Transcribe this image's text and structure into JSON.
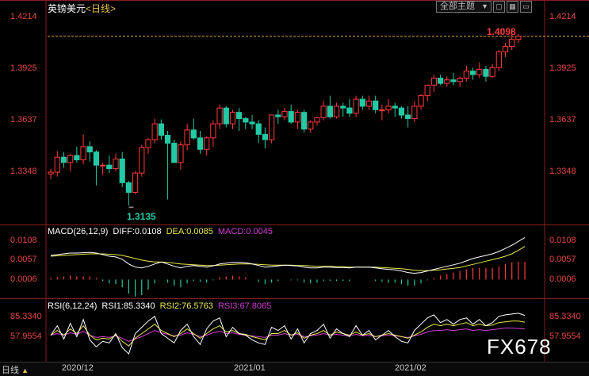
{
  "header": {
    "title": "英镑美元",
    "period_tag": "<日线>"
  },
  "toolbar": {
    "theme_select": "全部主题",
    "theme_arrow": "▼",
    "btn1": "▢",
    "btn2": "▦",
    "btn3": "▭"
  },
  "price_axis": {
    "labels": [
      "1.4214",
      "1.3925",
      "1.3637",
      "1.3348"
    ]
  },
  "markers": {
    "high": "1.4098",
    "low": "1.3135"
  },
  "macd": {
    "name": "MACD(26,12,9)",
    "diff": "DIFF:0.0108",
    "dea": "DEA:0.0085",
    "macd": "MACD:0.0045",
    "axis": [
      "0.0108",
      "0.0057",
      "0.0006"
    ]
  },
  "rsi": {
    "name": "RSI(6,12,24)",
    "rsi1": "RSI1:85.3340",
    "rsi2": "RSI2:76.5763",
    "rsi3": "RSI3:67.8065",
    "axis": [
      "85.3340",
      "57.9554"
    ]
  },
  "footer": {
    "period": "日线",
    "period_arrow": "▲",
    "dates": [
      "2020/12",
      "2021/01",
      "2021/02"
    ]
  },
  "watermark": "FX678",
  "colors": {
    "up": "#ff3b3b",
    "down": "#23c9a5",
    "diff": "#ffffff",
    "dea": "#e8e84a",
    "rsi3": "#d43bd4"
  },
  "chart_data": {
    "type": "candlestick",
    "title": "英镑美元 日线",
    "ylim": [
      1.305,
      1.4214
    ],
    "high_label": 1.4098,
    "low_label": 1.3135,
    "ohlc": [
      [
        1.3315,
        1.3345,
        1.3285,
        1.3325
      ],
      [
        1.3325,
        1.3445,
        1.33,
        1.341
      ],
      [
        1.341,
        1.344,
        1.335,
        1.338
      ],
      [
        1.338,
        1.343,
        1.333,
        1.342
      ],
      [
        1.342,
        1.347,
        1.338,
        1.3395
      ],
      [
        1.3395,
        1.354,
        1.337,
        1.347
      ],
      [
        1.347,
        1.35,
        1.3385,
        1.344
      ],
      [
        1.344,
        1.345,
        1.325,
        1.3365
      ],
      [
        1.3365,
        1.338,
        1.331,
        1.3365
      ],
      [
        1.3365,
        1.342,
        1.332,
        1.3345
      ],
      [
        1.3345,
        1.343,
        1.333,
        1.34
      ],
      [
        1.34,
        1.344,
        1.324,
        1.3265
      ],
      [
        1.3265,
        1.3275,
        1.3135,
        1.321
      ],
      [
        1.321,
        1.333,
        1.32,
        1.332
      ],
      [
        1.332,
        1.348,
        1.33,
        1.3465
      ],
      [
        1.3465,
        1.352,
        1.343,
        1.351
      ],
      [
        1.351,
        1.363,
        1.349,
        1.36
      ],
      [
        1.36,
        1.3625,
        1.351,
        1.3535
      ],
      [
        1.3535,
        1.356,
        1.317,
        1.349
      ],
      [
        1.349,
        1.351,
        1.338,
        1.338
      ],
      [
        1.338,
        1.35,
        1.334,
        1.348
      ],
      [
        1.348,
        1.36,
        1.345,
        1.3565
      ],
      [
        1.3565,
        1.363,
        1.351,
        1.352
      ],
      [
        1.352,
        1.356,
        1.343,
        1.3455
      ],
      [
        1.3455,
        1.353,
        1.342,
        1.352
      ],
      [
        1.352,
        1.362,
        1.347,
        1.36
      ],
      [
        1.36,
        1.371,
        1.357,
        1.369
      ],
      [
        1.369,
        1.37,
        1.358,
        1.36
      ],
      [
        1.36,
        1.368,
        1.357,
        1.3665
      ],
      [
        1.3665,
        1.369,
        1.356,
        1.363
      ],
      [
        1.363,
        1.364,
        1.357,
        1.361
      ],
      [
        1.361,
        1.365,
        1.357,
        1.36
      ],
      [
        1.36,
        1.362,
        1.349,
        1.354
      ],
      [
        1.354,
        1.358,
        1.346,
        1.351
      ],
      [
        1.351,
        1.365,
        1.349,
        1.365
      ],
      [
        1.365,
        1.368,
        1.36,
        1.364
      ],
      [
        1.364,
        1.369,
        1.362,
        1.367
      ],
      [
        1.367,
        1.371,
        1.36,
        1.361
      ],
      [
        1.361,
        1.368,
        1.357,
        1.3665
      ],
      [
        1.3665,
        1.368,
        1.355,
        1.357
      ],
      [
        1.357,
        1.362,
        1.355,
        1.361
      ],
      [
        1.361,
        1.364,
        1.359,
        1.3635
      ],
      [
        1.3635,
        1.373,
        1.362,
        1.37
      ],
      [
        1.37,
        1.376,
        1.363,
        1.364
      ],
      [
        1.364,
        1.372,
        1.363,
        1.37
      ],
      [
        1.37,
        1.372,
        1.364,
        1.369
      ],
      [
        1.369,
        1.374,
        1.364,
        1.366
      ],
      [
        1.366,
        1.376,
        1.364,
        1.374
      ],
      [
        1.374,
        1.376,
        1.368,
        1.37
      ],
      [
        1.37,
        1.376,
        1.368,
        1.373
      ],
      [
        1.373,
        1.376,
        1.366,
        1.368
      ],
      [
        1.368,
        1.371,
        1.362,
        1.368
      ],
      [
        1.368,
        1.374,
        1.366,
        1.37
      ],
      [
        1.37,
        1.372,
        1.364,
        1.369
      ],
      [
        1.369,
        1.37,
        1.363,
        1.365
      ],
      [
        1.365,
        1.37,
        1.358,
        1.363
      ],
      [
        1.363,
        1.373,
        1.361,
        1.37
      ],
      [
        1.37,
        1.377,
        1.368,
        1.376
      ],
      [
        1.376,
        1.382,
        1.373,
        1.382
      ],
      [
        1.382,
        1.388,
        1.378,
        1.386
      ],
      [
        1.386,
        1.388,
        1.382,
        1.383
      ],
      [
        1.383,
        1.387,
        1.381,
        1.385
      ],
      [
        1.385,
        1.389,
        1.382,
        1.384
      ],
      [
        1.384,
        1.387,
        1.381,
        1.386
      ],
      [
        1.386,
        1.393,
        1.384,
        1.39
      ],
      [
        1.39,
        1.392,
        1.385,
        1.388
      ],
      [
        1.388,
        1.395,
        1.386,
        1.391
      ],
      [
        1.391,
        1.393,
        1.384,
        1.387
      ],
      [
        1.387,
        1.394,
        1.386,
        1.392
      ],
      [
        1.392,
        1.402,
        1.39,
        1.401
      ],
      [
        1.401,
        1.406,
        1.398,
        1.404
      ],
      [
        1.404,
        1.411,
        1.402,
        1.408
      ],
      [
        1.408,
        1.411,
        1.406,
        1.4098
      ]
    ],
    "macd": {
      "ylim": [
        -0.004,
        0.0115
      ],
      "diff": [
        0.0062,
        0.0064,
        0.0066,
        0.0068,
        0.0068,
        0.0069,
        0.007,
        0.0068,
        0.0064,
        0.006,
        0.0058,
        0.0052,
        0.004,
        0.0032,
        0.003,
        0.0034,
        0.004,
        0.0045,
        0.004,
        0.0034,
        0.003,
        0.0034,
        0.0036,
        0.0034,
        0.0032,
        0.0035,
        0.004,
        0.0042,
        0.0044,
        0.0044,
        0.0043,
        0.004,
        0.0036,
        0.0032,
        0.0033,
        0.0035,
        0.0037,
        0.0036,
        0.0035,
        0.0032,
        0.003,
        0.003,
        0.0032,
        0.0032,
        0.0031,
        0.0031,
        0.003,
        0.0032,
        0.0032,
        0.0032,
        0.003,
        0.0028,
        0.0026,
        0.0025,
        0.0022,
        0.0018,
        0.0016,
        0.0018,
        0.0022,
        0.0026,
        0.003,
        0.0034,
        0.0038,
        0.0042,
        0.0048,
        0.0054,
        0.0058,
        0.0062,
        0.0066,
        0.0072,
        0.008,
        0.0088,
        0.0098,
        0.0108
      ],
      "dea": [
        0.006,
        0.0061,
        0.0062,
        0.0063,
        0.0064,
        0.0065,
        0.0066,
        0.0066,
        0.0066,
        0.0065,
        0.0064,
        0.0062,
        0.0058,
        0.0054,
        0.005,
        0.0047,
        0.0045,
        0.0045,
        0.0044,
        0.0042,
        0.004,
        0.0039,
        0.0038,
        0.0037,
        0.0036,
        0.0036,
        0.0037,
        0.0038,
        0.0039,
        0.004,
        0.004,
        0.004,
        0.0039,
        0.0038,
        0.0037,
        0.0037,
        0.0037,
        0.0037,
        0.0036,
        0.0036,
        0.0035,
        0.0034,
        0.0034,
        0.0034,
        0.0033,
        0.0033,
        0.0032,
        0.0032,
        0.0032,
        0.0032,
        0.0032,
        0.0031,
        0.003,
        0.0029,
        0.0028,
        0.0026,
        0.0024,
        0.0023,
        0.0023,
        0.0024,
        0.0025,
        0.0027,
        0.0029,
        0.0031,
        0.0035,
        0.0039,
        0.0043,
        0.0047,
        0.0051,
        0.0055,
        0.006,
        0.0066,
        0.0075,
        0.0085
      ],
      "hist": [
        0.0004,
        0.0006,
        0.0008,
        0.001,
        0.0008,
        0.0008,
        0.0008,
        0.0004,
        -0.0004,
        -0.001,
        -0.0012,
        -0.002,
        -0.0036,
        -0.0044,
        -0.004,
        -0.0026,
        -0.001,
        0.0,
        -0.0008,
        -0.0016,
        -0.002,
        -0.001,
        -0.0004,
        -0.0006,
        -0.0008,
        -0.0002,
        0.0006,
        0.0008,
        0.001,
        0.0008,
        0.0006,
        0.0,
        -0.0006,
        -0.0012,
        -0.0008,
        -0.0004,
        0.0,
        -0.0002,
        -0.0002,
        -0.0008,
        -0.001,
        -0.0008,
        -0.0004,
        -0.0004,
        -0.0004,
        -0.0004,
        -0.0004,
        0.0,
        0.0,
        0.0,
        -0.0004,
        -0.0006,
        -0.0008,
        -0.0008,
        -0.0012,
        -0.0016,
        -0.0016,
        -0.001,
        -0.0002,
        0.0004,
        0.001,
        0.0014,
        0.0018,
        0.0022,
        0.0026,
        0.003,
        0.003,
        0.003,
        0.003,
        0.0034,
        0.004,
        0.0044,
        0.0046,
        0.0046
      ]
    },
    "rsi": {
      "ylim": [
        30,
        95
      ],
      "rsi1": [
        60,
        72,
        55,
        75,
        58,
        80,
        54,
        45,
        52,
        50,
        62,
        44,
        36,
        62,
        70,
        78,
        84,
        62,
        56,
        50,
        66,
        74,
        58,
        48,
        68,
        78,
        82,
        58,
        70,
        62,
        60,
        54,
        50,
        48,
        70,
        66,
        72,
        55,
        68,
        50,
        62,
        66,
        74,
        56,
        68,
        62,
        58,
        72,
        60,
        66,
        54,
        60,
        66,
        58,
        52,
        50,
        66,
        74,
        82,
        86,
        76,
        80,
        74,
        80,
        82,
        74,
        80,
        72,
        76,
        84,
        86,
        87,
        88,
        85.3
      ],
      "rsi2": [
        60,
        66,
        60,
        68,
        62,
        72,
        60,
        54,
        56,
        55,
        60,
        52,
        46,
        56,
        62,
        68,
        74,
        66,
        62,
        58,
        62,
        68,
        62,
        56,
        62,
        68,
        72,
        64,
        66,
        62,
        61,
        58,
        56,
        54,
        62,
        62,
        66,
        60,
        63,
        56,
        60,
        62,
        66,
        60,
        64,
        62,
        60,
        64,
        60,
        62,
        58,
        60,
        62,
        60,
        58,
        56,
        60,
        64,
        70,
        74,
        72,
        74,
        72,
        74,
        76,
        72,
        74,
        72,
        73,
        76,
        77,
        78,
        78,
        76.6
      ],
      "rsi3": [
        60,
        62,
        60,
        63,
        61,
        65,
        60,
        57,
        58,
        57,
        59,
        56,
        52,
        55,
        58,
        62,
        66,
        63,
        61,
        59,
        60,
        63,
        61,
        58,
        60,
        63,
        65,
        62,
        63,
        61,
        60,
        59,
        58,
        57,
        60,
        60,
        62,
        60,
        61,
        58,
        59,
        60,
        62,
        60,
        61,
        60,
        59,
        61,
        59,
        60,
        58,
        59,
        60,
        59,
        58,
        57,
        59,
        61,
        64,
        66,
        66,
        67,
        66,
        67,
        68,
        66,
        67,
        66,
        67,
        68,
        69,
        69,
        68.5,
        67.8
      ]
    }
  }
}
